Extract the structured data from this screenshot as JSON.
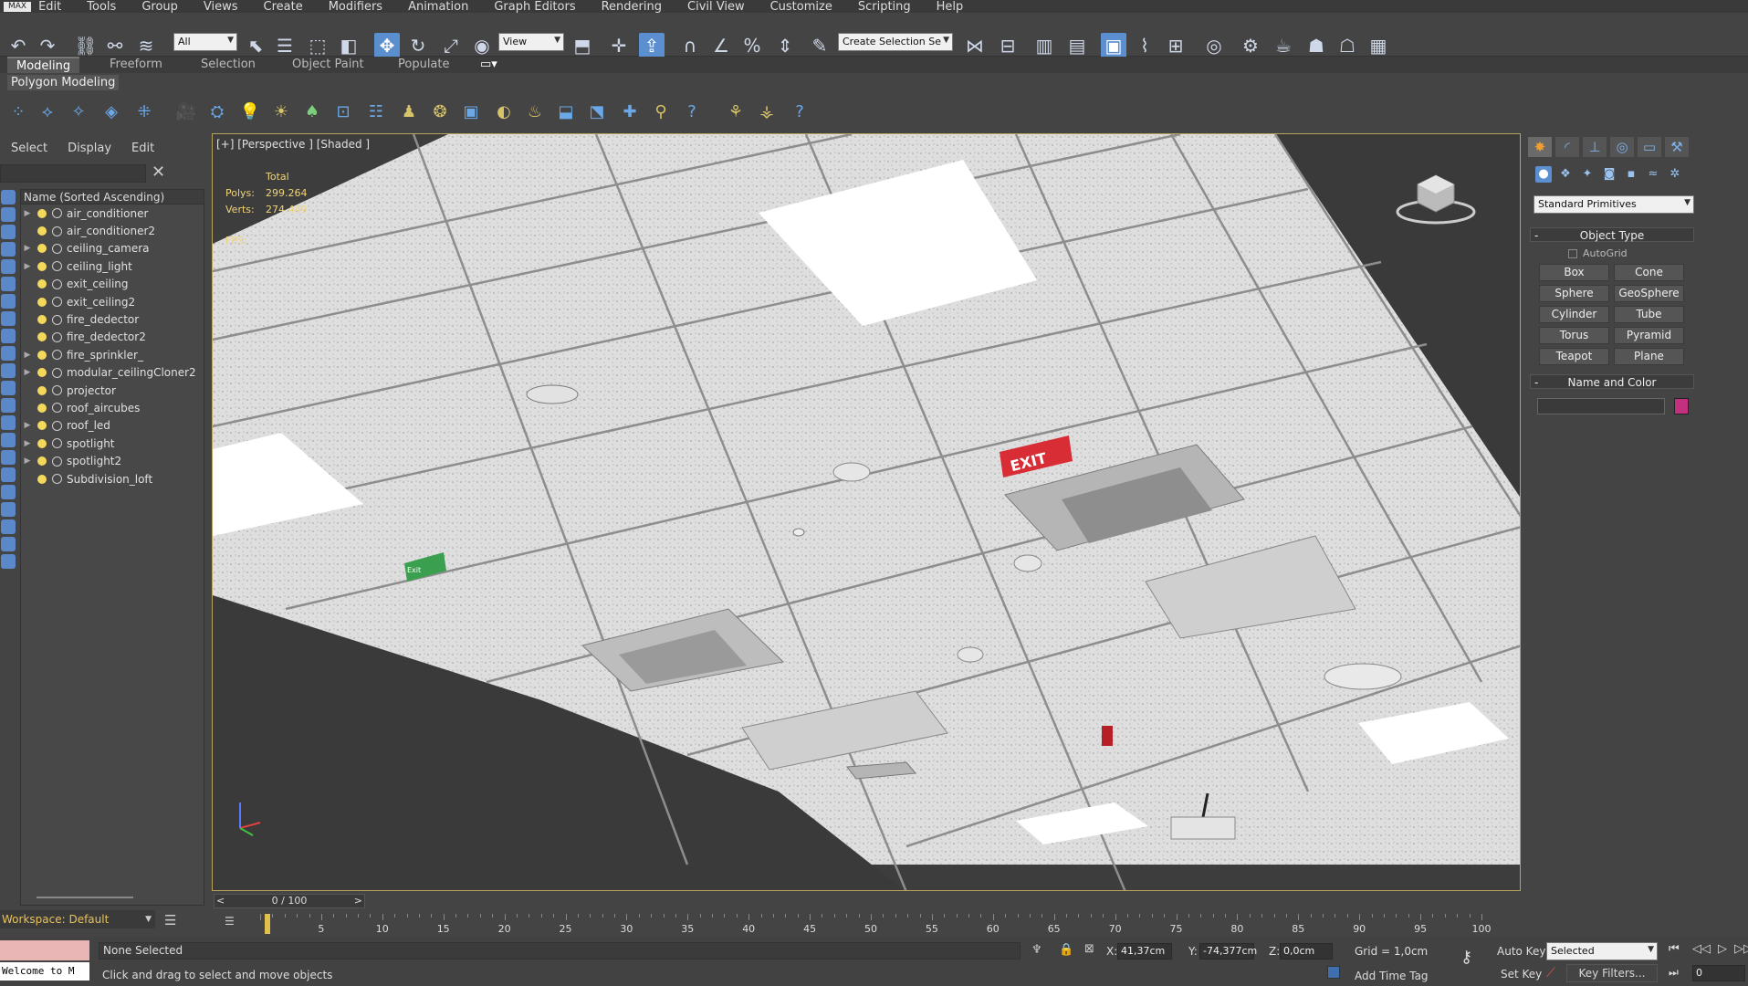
{
  "app": {
    "logo": "MAX"
  },
  "menu": [
    "Edit",
    "Tools",
    "Group",
    "Views",
    "Create",
    "Modifiers",
    "Animation",
    "Graph Editors",
    "Rendering",
    "Civil View",
    "Customize",
    "Scripting",
    "Help"
  ],
  "toolbar": {
    "filter_value": "All",
    "ref_coord_value": "View",
    "selection_set_placeholder": "Create Selection Se"
  },
  "ribbon": {
    "tabs": [
      "Modeling",
      "Freeform",
      "Selection",
      "Object Paint",
      "Populate"
    ],
    "active_tab": "Modeling",
    "panel_label": "Polygon Modeling"
  },
  "scene_explorer": {
    "menu": [
      "Select",
      "Display",
      "Edit"
    ],
    "column_header": "Name (Sorted Ascending)",
    "items": [
      {
        "name": "air_conditioner",
        "expandable": true
      },
      {
        "name": "air_conditioner2",
        "expandable": false
      },
      {
        "name": "ceiling_camera",
        "expandable": true
      },
      {
        "name": "ceiling_light",
        "expandable": true
      },
      {
        "name": "exit_ceiling",
        "expandable": false
      },
      {
        "name": "exit_ceiling2",
        "expandable": false
      },
      {
        "name": "fire_dedector",
        "expandable": false
      },
      {
        "name": "fire_dedector2",
        "expandable": false
      },
      {
        "name": "fire_sprinkler_",
        "expandable": true
      },
      {
        "name": "modular_ceilingCloner2",
        "expandable": true
      },
      {
        "name": "projector",
        "expandable": false
      },
      {
        "name": "roof_aircubes",
        "expandable": false
      },
      {
        "name": "roof_led",
        "expandable": true
      },
      {
        "name": "spotlight",
        "expandable": true
      },
      {
        "name": "spotlight2",
        "expandable": true
      },
      {
        "name": "Subdivision_loft",
        "expandable": false
      }
    ]
  },
  "viewport": {
    "label": "[+] [Perspective ] [Shaded ]",
    "stats_header": "Total",
    "polys_label": "Polys:",
    "polys_value": "299.264",
    "verts_label": "Verts:",
    "verts_value": "274.449",
    "fps_label": "FPS:",
    "exit_sign_text": "EXIT",
    "green_sign_text": "Exit"
  },
  "command_panel": {
    "category_value": "Standard Primitives",
    "object_type_title": "Object Type",
    "autogrid_label": "AutoGrid",
    "buttons": [
      "Box",
      "Cone",
      "Sphere",
      "GeoSphere",
      "Cylinder",
      "Tube",
      "Torus",
      "Pyramid",
      "Teapot",
      "Plane"
    ],
    "name_color_title": "Name and Color",
    "object_color": "#c2307f"
  },
  "timeline": {
    "slider_label": "0 / 100",
    "ticks": [
      0,
      5,
      10,
      15,
      20,
      25,
      30,
      35,
      40,
      45,
      50,
      55,
      60,
      65,
      70,
      75,
      80,
      85,
      90,
      95,
      100
    ]
  },
  "workspace": {
    "label": "Workspace: Default"
  },
  "status": {
    "maxscript_text": "Welcome to M",
    "selection_text": "None Selected",
    "prompt_text": "Click and drag to select and move objects",
    "x_label": "X:",
    "x_value": "41,37cm",
    "y_label": "Y:",
    "y_value": "-74,377cm",
    "z_label": "Z:",
    "z_value": "0,0cm",
    "grid_text": "Grid = 1,0cm",
    "add_time_tag": "Add Time Tag",
    "auto_key": "Auto Key",
    "set_key": "Set Key",
    "selected_value": "Selected",
    "key_filters": "Key Filters...",
    "frame_value": "0"
  }
}
